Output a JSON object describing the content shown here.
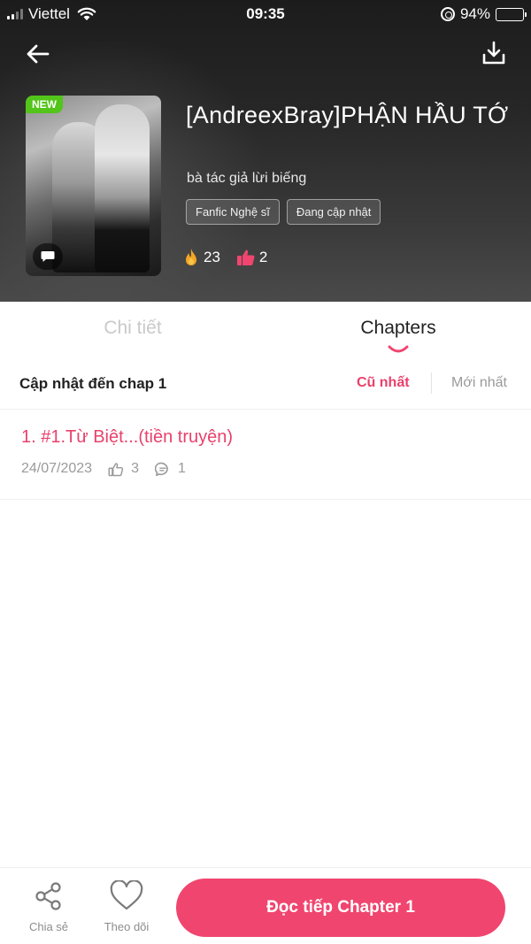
{
  "status_bar": {
    "carrier": "Viettel",
    "time": "09:35",
    "battery_pct": "94%",
    "battery_level": 0.94,
    "icons": [
      "signal-icon",
      "wifi-icon",
      "rotation-lock-icon",
      "battery-icon"
    ]
  },
  "header": {
    "back_icon": "arrow-left-icon",
    "download_icon": "download-icon"
  },
  "story": {
    "badge": "NEW",
    "title": "[AndreexBray]PHẬN HẦU TỚ",
    "author": "bà tác giả lừi biếng",
    "tags": [
      "Fanfic Nghệ sĩ",
      "Đang cập nhật"
    ],
    "views": "23",
    "likes": "2"
  },
  "tabs": [
    {
      "label": "Chi tiết",
      "active": false
    },
    {
      "label": "Chapters",
      "active": true
    }
  ],
  "chapters_header": {
    "update_text": "Cập nhật đến chap 1",
    "sort_oldest": "Cũ nhất",
    "sort_newest": "Mới nhất"
  },
  "chapters": [
    {
      "title": "1. #1.Từ Biệt...(tiền truyện)",
      "date": "24/07/2023",
      "likes": "3",
      "comments": "1"
    }
  ],
  "bottom_bar": {
    "share_label": "Chia sẻ",
    "follow_label": "Theo dõi",
    "read_button": "Đọc tiếp Chapter 1"
  },
  "colors": {
    "accent": "#f0456f",
    "accent_text": "#e8416b",
    "new_badge": "#52c41a"
  }
}
